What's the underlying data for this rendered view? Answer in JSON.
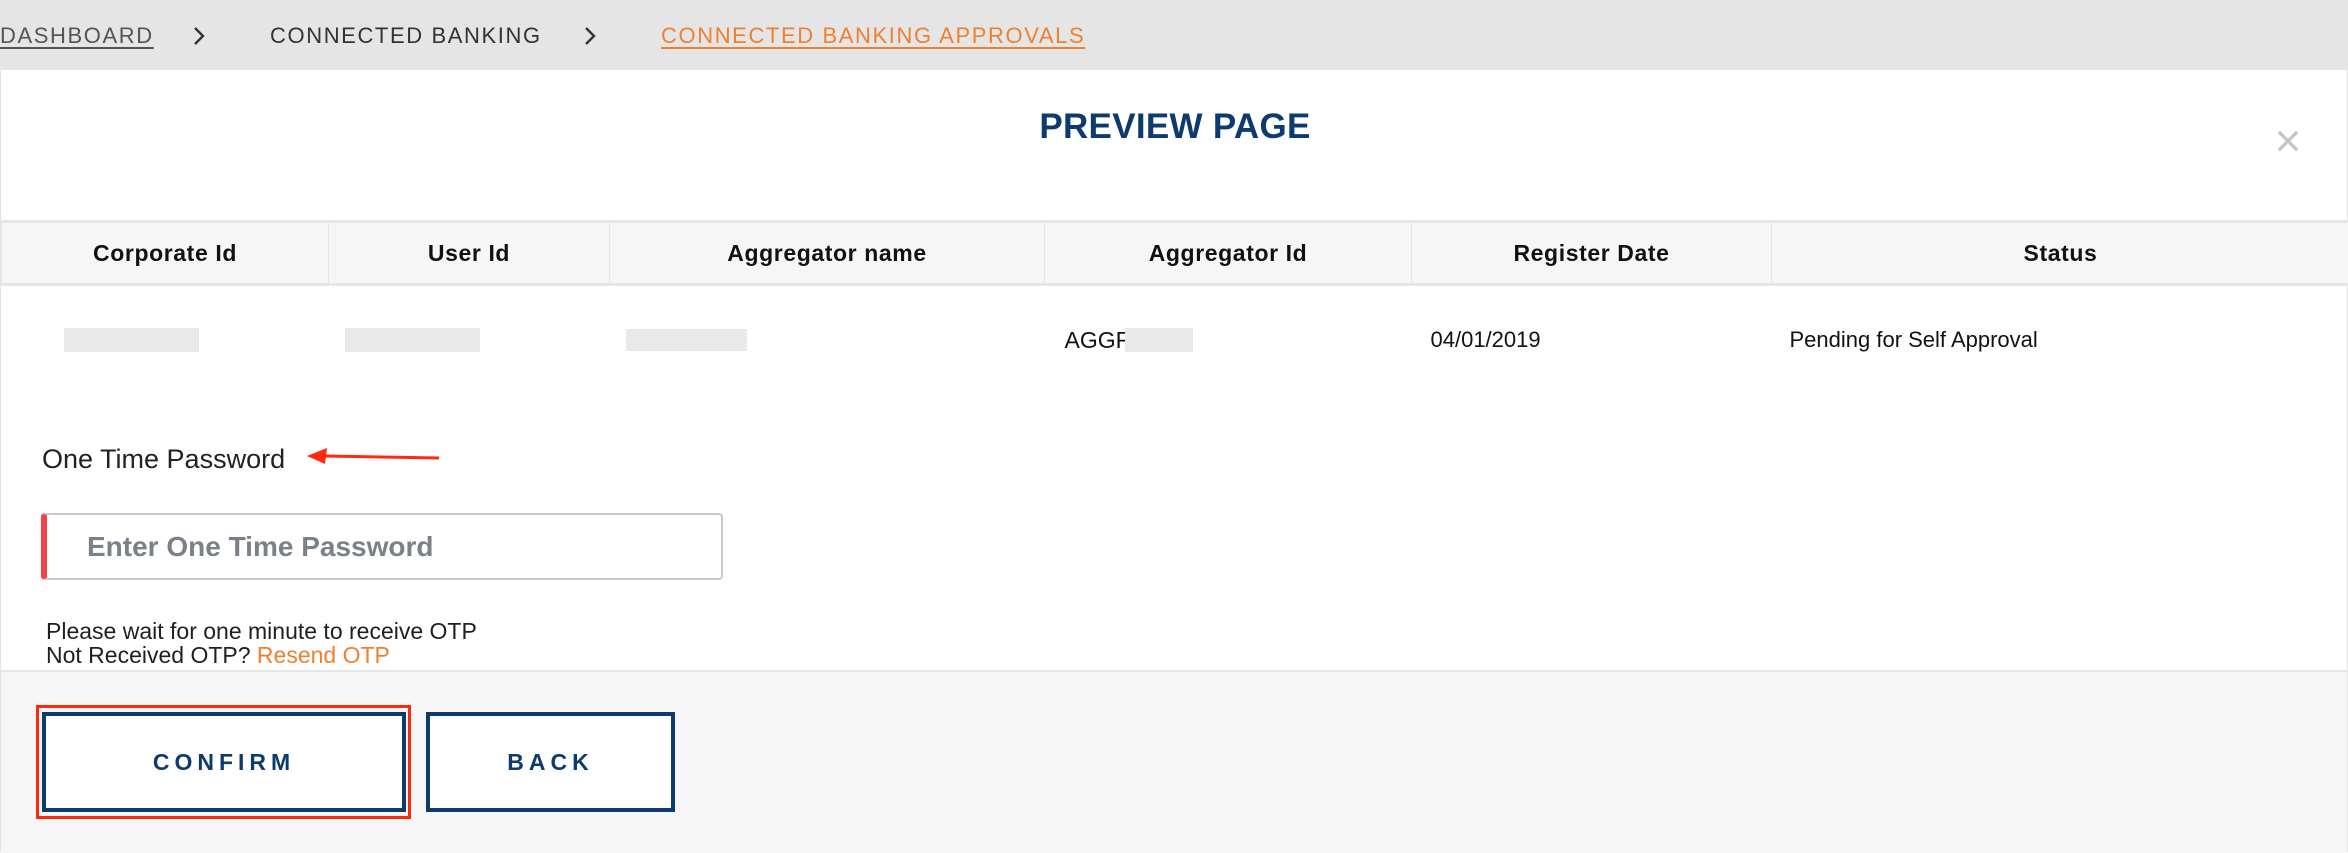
{
  "breadcrumb": {
    "items": [
      {
        "label": "DASHBOARD",
        "state": "link"
      },
      {
        "label": "CONNECTED BANKING",
        "state": "plain"
      },
      {
        "label": "CONNECTED BANKING APPROVALS",
        "state": "active"
      }
    ],
    "separator_icon": "chevron-right-icon"
  },
  "modal": {
    "title": "PREVIEW PAGE",
    "close_icon": "close-icon"
  },
  "table": {
    "columns": [
      "Corporate Id",
      "User Id",
      "Aggregator name",
      "Aggregator Id",
      "Register Date",
      "Status"
    ],
    "rows": [
      {
        "corporate_id": "",
        "user_id": "",
        "aggregator_name": "",
        "aggregator_id": "AGGR",
        "register_date": "04/01/2019",
        "status": "Pending for Self Approval"
      }
    ],
    "redacted_fields": [
      "corporate_id",
      "user_id",
      "aggregator_name",
      "aggregator_id (partial)"
    ]
  },
  "otp": {
    "label": "One Time Password",
    "value": "",
    "placeholder": "Enter One Time Password",
    "help_line1": "Please wait for one minute to receive OTP",
    "help_line2_prefix": "Not Received OTP?",
    "resend_label": "Resend OTP"
  },
  "actions": {
    "confirm_label": "CONFIRM",
    "back_label": "BACK"
  },
  "annotations": {
    "arrow_target": "One Time Password",
    "highlight_target": "CONFIRM"
  },
  "colors": {
    "accent_orange": "#f08030",
    "primary_navy": "#0d3b6e",
    "required_red": "#f2434a",
    "annotation_red": "#ff2a0d"
  }
}
